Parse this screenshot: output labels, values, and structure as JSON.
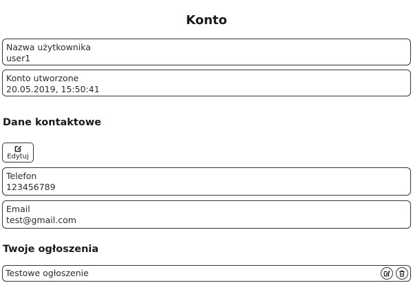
{
  "header": {
    "title": "Konto"
  },
  "account": {
    "username_label": "Nazwa użytkownika",
    "username_value": "user1",
    "created_label": "Konto utworzone",
    "created_value": "20.05.2019, 15:50:41"
  },
  "contact": {
    "heading": "Dane kontaktowe",
    "edit_label": "Edytuj",
    "phone_label": "Telefon",
    "phone_value": "123456789",
    "email_label": "Email",
    "email_value": "test@gmail.com"
  },
  "ads": {
    "heading": "Twoje ogłoszenia",
    "items": [
      {
        "title": "Testowe ogłoszenie"
      }
    ]
  },
  "icons": {
    "edit": "edit-icon",
    "delete": "trash-icon"
  },
  "colors": {
    "border": "#333333",
    "text": "#222222",
    "background": "#ffffff"
  }
}
